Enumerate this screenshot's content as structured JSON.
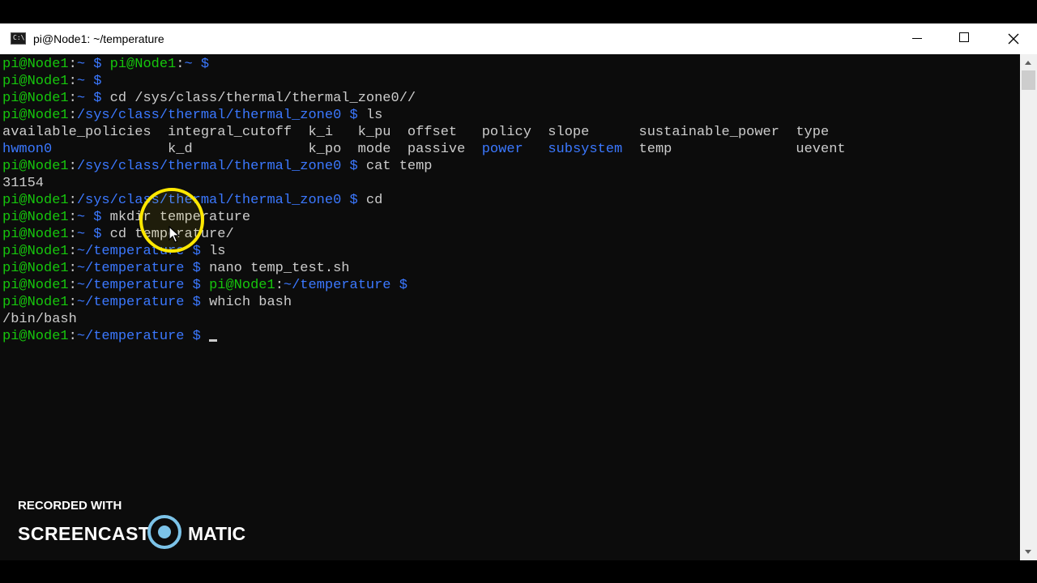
{
  "window": {
    "title": "pi@Node1: ~/temperature",
    "icon": "terminal-icon"
  },
  "controls": {
    "minimize_icon": "minimize-icon",
    "maximize_icon": "maximize-icon",
    "close_icon": "close-icon"
  },
  "terminal": {
    "lines": [
      [
        [
          "g",
          "pi@Node1"
        ],
        [
          "w",
          ":"
        ],
        [
          "b",
          "~ $ "
        ],
        [
          "g",
          "pi@Node1"
        ],
        [
          "w",
          ":"
        ],
        [
          "b",
          "~ $"
        ]
      ],
      [
        [
          "g",
          "pi@Node1"
        ],
        [
          "w",
          ":"
        ],
        [
          "b",
          "~ $"
        ]
      ],
      [
        [
          "g",
          "pi@Node1"
        ],
        [
          "w",
          ":"
        ],
        [
          "b",
          "~ $ "
        ],
        [
          "w",
          "cd /sys/class/thermal/thermal_zone0//"
        ]
      ],
      [
        [
          "g",
          "pi@Node1"
        ],
        [
          "w",
          ":"
        ],
        [
          "b",
          "/sys/class/thermal/thermal_zone0 $ "
        ],
        [
          "w",
          "ls"
        ]
      ],
      [
        [
          "w",
          "available_policies  integral_cutoff  k_i   k_pu  offset   policy  slope      sustainable_power  type"
        ]
      ],
      [
        [
          "b",
          "hwmon0"
        ],
        [
          "w",
          "              k_d              k_po  mode  passive  "
        ],
        [
          "b",
          "power"
        ],
        [
          "w",
          "   "
        ],
        [
          "b",
          "subsystem"
        ],
        [
          "w",
          "  temp               uevent"
        ]
      ],
      [
        [
          "g",
          "pi@Node1"
        ],
        [
          "w",
          ":"
        ],
        [
          "b",
          "/sys/class/thermal/thermal_zone0 $ "
        ],
        [
          "w",
          "cat temp"
        ]
      ],
      [
        [
          "w",
          "31154"
        ]
      ],
      [
        [
          "g",
          "pi@Node1"
        ],
        [
          "w",
          ":"
        ],
        [
          "b",
          "/sys/class/thermal/thermal_zone0 $ "
        ],
        [
          "w",
          "cd"
        ]
      ],
      [
        [
          "g",
          "pi@Node1"
        ],
        [
          "w",
          ":"
        ],
        [
          "b",
          "~ $ "
        ],
        [
          "w",
          "mkdir temperature"
        ]
      ],
      [
        [
          "g",
          "pi@Node1"
        ],
        [
          "w",
          ":"
        ],
        [
          "b",
          "~ $ "
        ],
        [
          "w",
          "cd temperature/"
        ]
      ],
      [
        [
          "g",
          "pi@Node1"
        ],
        [
          "w",
          ":"
        ],
        [
          "b",
          "~/temperature $ "
        ],
        [
          "w",
          "ls"
        ]
      ],
      [
        [
          "g",
          "pi@Node1"
        ],
        [
          "w",
          ":"
        ],
        [
          "b",
          "~/temperature $ "
        ],
        [
          "w",
          "nano temp_test.sh"
        ]
      ],
      [
        [
          "g",
          "pi@Node1"
        ],
        [
          "w",
          ":"
        ],
        [
          "b",
          "~/temperature $ "
        ],
        [
          "g",
          "pi@Node1"
        ],
        [
          "w",
          ":"
        ],
        [
          "b",
          "~/temperature $"
        ]
      ],
      [
        [
          "g",
          "pi@Node1"
        ],
        [
          "w",
          ":"
        ],
        [
          "b",
          "~/temperature $ "
        ],
        [
          "w",
          "which bash"
        ]
      ],
      [
        [
          "w",
          "/bin/bash"
        ]
      ],
      [
        [
          "g",
          "pi@Node1"
        ],
        [
          "w",
          ":"
        ],
        [
          "b",
          "~/temperature $ "
        ]
      ]
    ],
    "colors": {
      "background": "#0c0c0c",
      "prompt_green": "#16c60c",
      "path_blue": "#3b78ff",
      "text": "#cccccc"
    }
  },
  "watermark": {
    "top": "RECORDED WITH",
    "left": "SCREENCAST",
    "right": "MATIC",
    "accent": "#7cc3e8"
  }
}
